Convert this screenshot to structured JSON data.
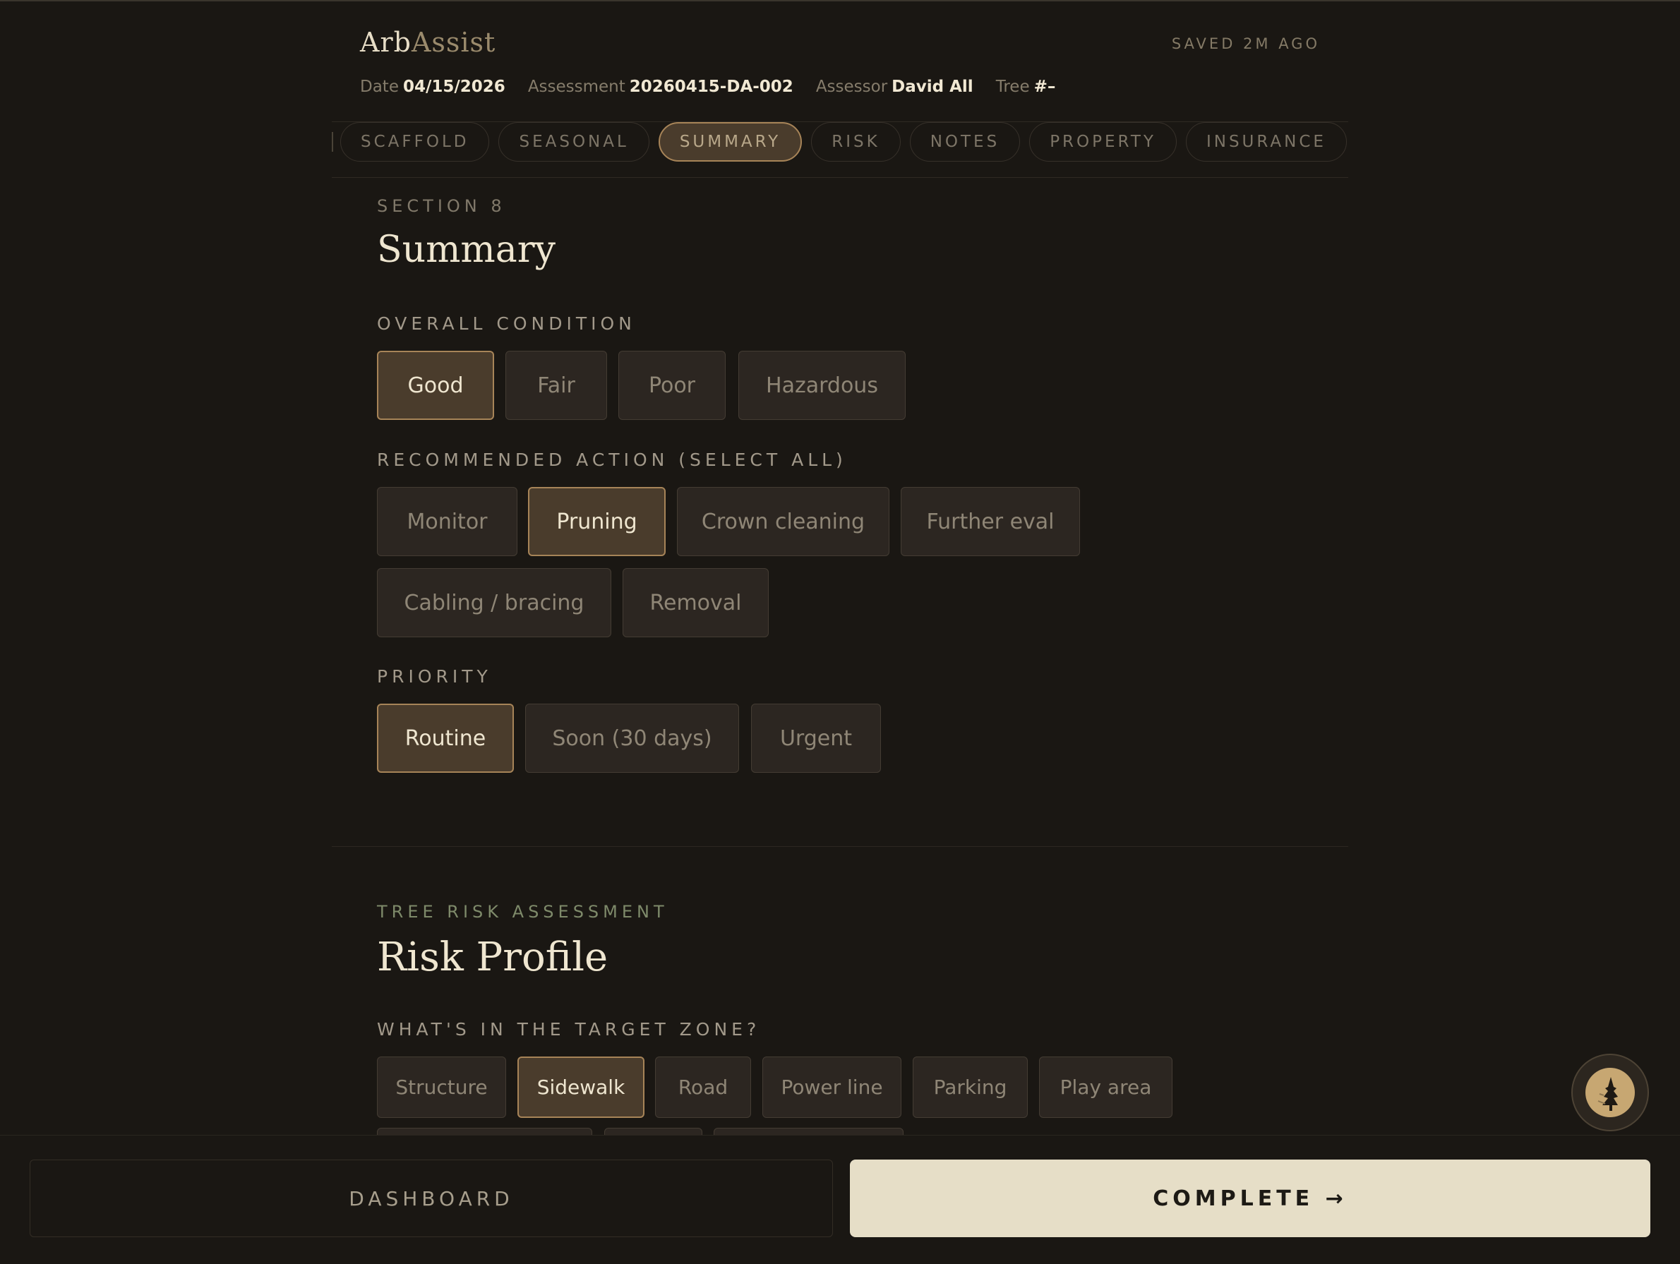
{
  "app": {
    "brand_a": "Arb",
    "brand_b": "Assist",
    "saved_status": "SAVED 2M AGO"
  },
  "meta": {
    "date_label": "Date",
    "date_value": "04/15/2026",
    "assessment_label": "Assessment",
    "assessment_value": "20260415-DA-002",
    "assessor_label": "Assessor",
    "assessor_value": "David All",
    "tree_label": "Tree",
    "tree_value": "#–"
  },
  "tabs": [
    {
      "label": "SCAFFOLD"
    },
    {
      "label": "SEASONAL"
    },
    {
      "label": "SUMMARY",
      "active": true
    },
    {
      "label": "RISK"
    },
    {
      "label": "NOTES"
    },
    {
      "label": "PROPERTY"
    },
    {
      "label": "INSURANCE"
    }
  ],
  "summary": {
    "eyebrow": "SECTION 8",
    "title": "Summary",
    "condition_label": "OVERALL CONDITION",
    "condition_options": [
      "Good",
      "Fair",
      "Poor",
      "Hazardous"
    ],
    "condition_selected": "Good",
    "action_label": "RECOMMENDED ACTION (SELECT ALL)",
    "action_options": [
      "Monitor",
      "Pruning",
      "Crown cleaning",
      "Further eval",
      "Cabling / bracing",
      "Removal"
    ],
    "action_selected": [
      "Pruning"
    ],
    "priority_label": "PRIORITY",
    "priority_options": [
      "Routine",
      "Soon (30 days)",
      "Urgent"
    ],
    "priority_selected": "Routine"
  },
  "risk": {
    "eyebrow": "TREE RISK ASSESSMENT",
    "title": "Risk Profile",
    "target_label": "WHAT'S IN THE TARGET ZONE?",
    "target_options": [
      "Structure",
      "Sidewalk",
      "Road",
      "Power line",
      "Parking",
      "Play area"
    ],
    "target_selected": [
      "Sidewalk"
    ]
  },
  "footer": {
    "dashboard_label": "DASHBOARD",
    "complete_label": "COMPLETE →"
  },
  "colors": {
    "background": "#1a1713",
    "accent": "#a78458",
    "selected_fill": "#4a3c2c",
    "complete_button": "#e6dec7"
  }
}
